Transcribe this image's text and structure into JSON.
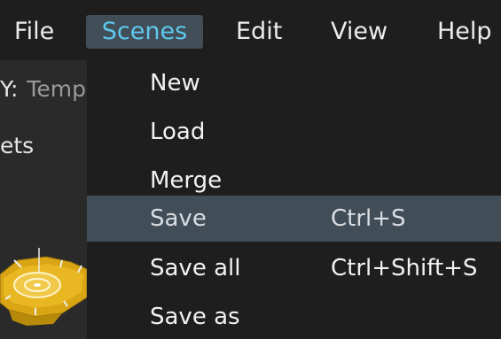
{
  "menubar": {
    "items": [
      {
        "label": "File"
      },
      {
        "label": "Scenes"
      },
      {
        "label": "Edit"
      },
      {
        "label": "View"
      },
      {
        "label": "Help"
      }
    ],
    "active": "Scenes",
    "active_color": "#5ec8ee"
  },
  "left_panel": {
    "query_label": "Y:",
    "query_value": "Templ",
    "assets_label": "ets",
    "thumbnail_icon": "gold-stadium-model-icon"
  },
  "dropdown": {
    "items": [
      {
        "label": "New",
        "shortcut": ""
      },
      {
        "label": "Load",
        "shortcut": ""
      },
      {
        "label": "Merge",
        "shortcut": ""
      },
      {
        "label": "Save",
        "shortcut": "Ctrl+S"
      },
      {
        "label": "Save all",
        "shortcut": "Ctrl+Shift+S"
      },
      {
        "label": "Save as",
        "shortcut": ""
      }
    ],
    "highlighted": "Save",
    "highlight_color": "#414d57"
  }
}
